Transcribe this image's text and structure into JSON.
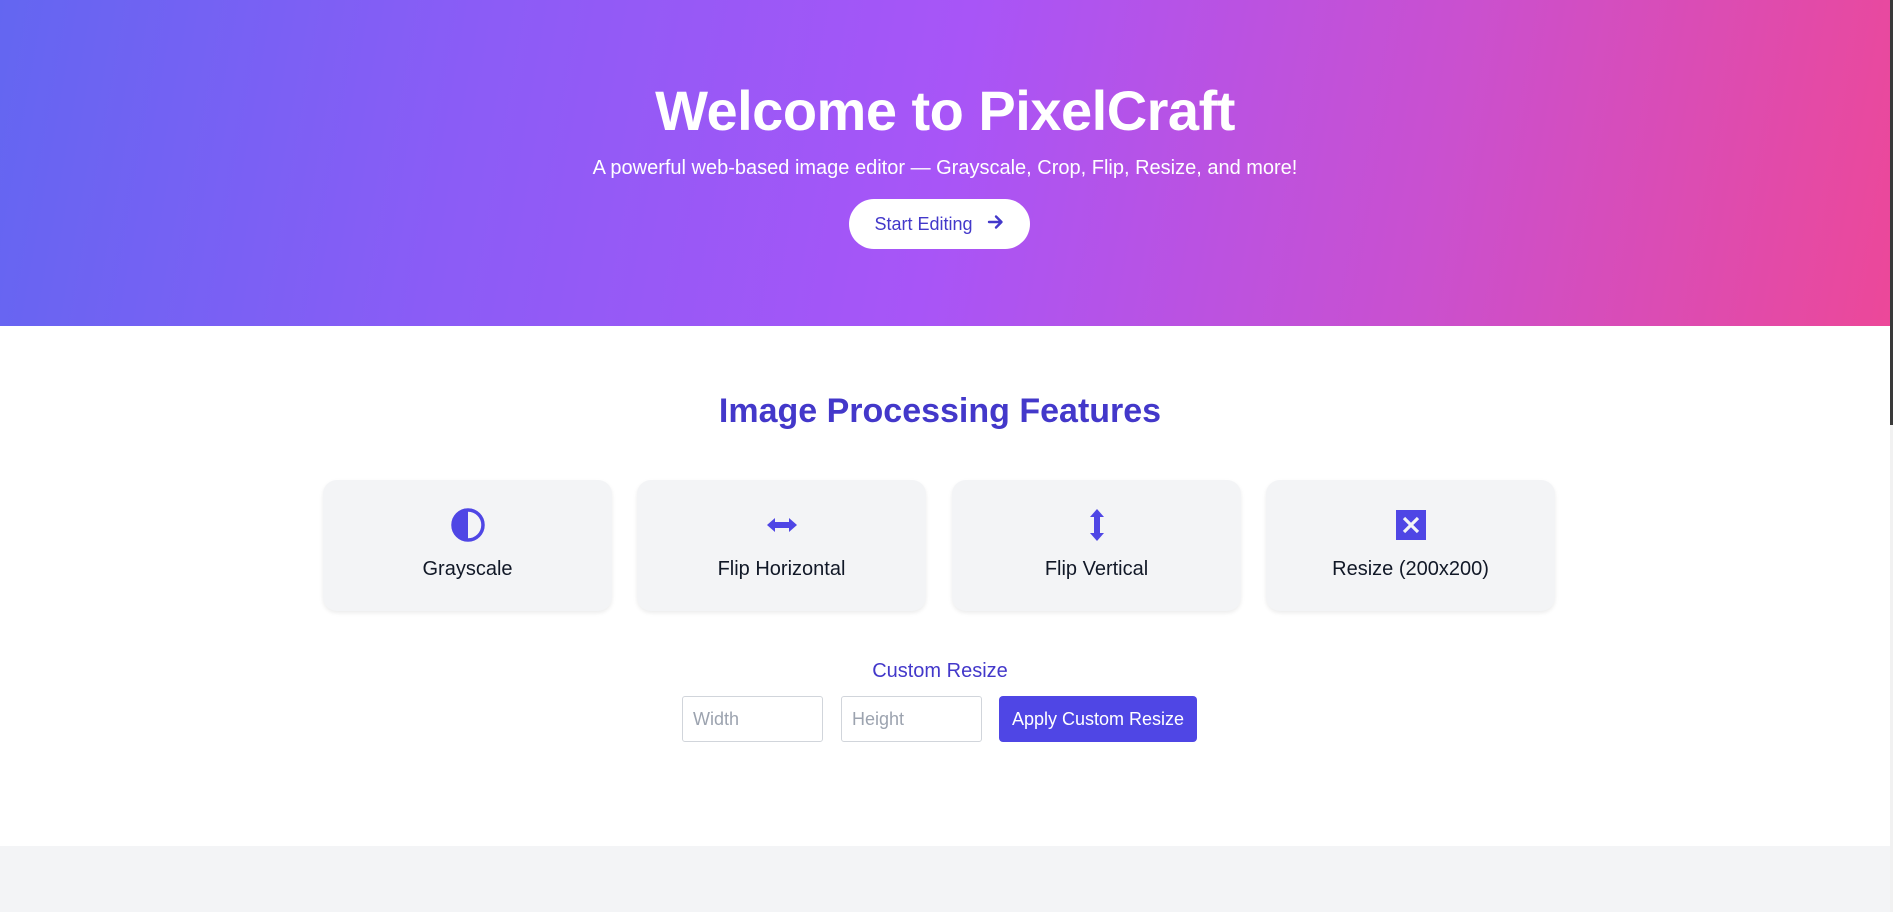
{
  "hero": {
    "title": "Welcome to PixelCraft",
    "subtitle": "A powerful web-based image editor — Grayscale, Crop, Flip, Resize, and more!",
    "start_button_label": "Start Editing",
    "start_button_icon": "arrow-right-icon"
  },
  "features": {
    "title": "Image Processing Features",
    "cards": [
      {
        "label": "Grayscale",
        "icon": "adjust-contrast-icon"
      },
      {
        "label": "Flip Horizontal",
        "icon": "arrows-horizontal-icon"
      },
      {
        "label": "Flip Vertical",
        "icon": "arrows-vertical-icon"
      },
      {
        "label": "Resize (200x200)",
        "icon": "expand-arrows-icon"
      }
    ]
  },
  "custom_resize": {
    "title": "Custom Resize",
    "width_placeholder": "Width",
    "height_placeholder": "Height",
    "apply_label": "Apply Custom Resize"
  },
  "colors": {
    "accent": "#4f46e5",
    "heading": "#4338ca",
    "gradient_start": "#6366f1",
    "gradient_mid": "#a855f7",
    "gradient_end": "#ec4899",
    "card_bg": "#f3f4f6"
  }
}
